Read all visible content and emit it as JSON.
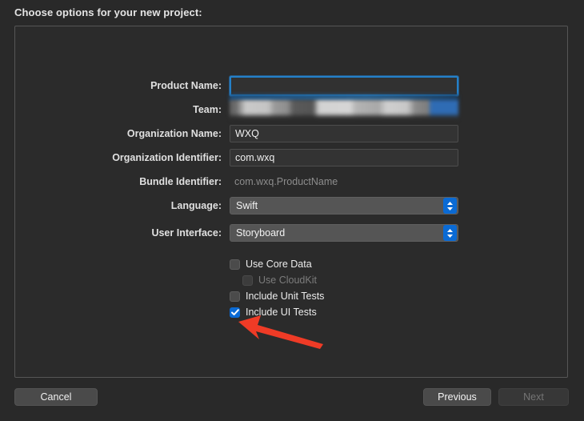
{
  "dialog": {
    "title": "Choose options for your new project:"
  },
  "form": {
    "fields": [
      {
        "label": "Product Name:",
        "value": "",
        "type": "text",
        "focused": true
      },
      {
        "label": "Team:",
        "value": "",
        "type": "popup-redacted",
        "focused": false
      },
      {
        "label": "Organization Name:",
        "value": "WXQ",
        "type": "text",
        "focused": false
      },
      {
        "label": "Organization Identifier:",
        "value": "com.wxq",
        "type": "text",
        "focused": false
      },
      {
        "label": "Bundle Identifier:",
        "value": "com.wxq.ProductName",
        "type": "static",
        "focused": false
      },
      {
        "label": "Language:",
        "value": "Swift",
        "type": "popup",
        "focused": false
      },
      {
        "label": "User Interface:",
        "value": "Storyboard",
        "type": "popup",
        "focused": false
      }
    ]
  },
  "options": {
    "checkboxes": [
      {
        "label": "Use Core Data",
        "checked": false,
        "disabled": false,
        "indent": 0
      },
      {
        "label": "Use CloudKit",
        "checked": false,
        "disabled": true,
        "indent": 16
      },
      {
        "label": "Include Unit Tests",
        "checked": false,
        "disabled": false,
        "indent": 0
      },
      {
        "label": "Include UI Tests",
        "checked": true,
        "disabled": false,
        "indent": 0
      }
    ]
  },
  "footer": {
    "cancel_label": "Cancel",
    "previous_label": "Previous",
    "next_label": "Next"
  },
  "annotation": {
    "arrow_color": "#ef3b26",
    "points_to": "Include UI Tests"
  },
  "colors": {
    "background": "#292929",
    "panel": "#2b2b2b",
    "accent_blue": "#0a6ad4",
    "focus_ring": "#2480c8",
    "field_background": "#333333",
    "popup_background": "#555555"
  }
}
